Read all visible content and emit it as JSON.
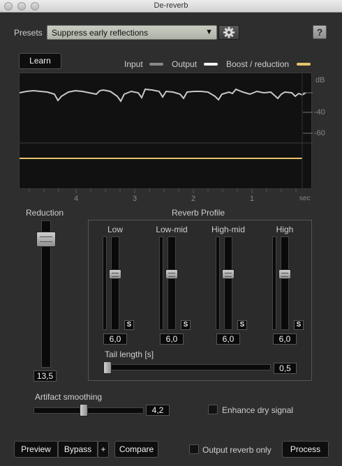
{
  "window": {
    "title": "De-reverb"
  },
  "presets": {
    "label": "Presets",
    "selected": "Suppress early reflections"
  },
  "help_label": "?",
  "learn_label": "Learn",
  "legend": [
    {
      "label": "Input",
      "color": "#8a8a8a"
    },
    {
      "label": "Output",
      "color": "#f4f4f4"
    },
    {
      "label": "Boost / reduction",
      "color": "#e8c46a"
    }
  ],
  "display": {
    "db_label": "dB",
    "db_ticks": [
      "-40",
      "-60"
    ],
    "time_ticks": [
      "4",
      "3",
      "2",
      "1"
    ],
    "time_unit": "sec"
  },
  "reduction": {
    "label": "Reduction",
    "value": "13,5",
    "level": 0.87
  },
  "reverb_profile": {
    "title": "Reverb Profile",
    "bands": [
      {
        "label": "Low",
        "value": "6,0",
        "solo": "S",
        "level": 0.6
      },
      {
        "label": "Low-mid",
        "value": "6,0",
        "solo": "S",
        "level": 0.6
      },
      {
        "label": "High-mid",
        "value": "6,0",
        "solo": "S",
        "level": 0.6
      },
      {
        "label": "High",
        "value": "6,0",
        "solo": "S",
        "level": 0.6
      }
    ],
    "tail_length": {
      "label": "Tail length [s]",
      "value": "0,5",
      "level": 0.0
    }
  },
  "artifact_smoothing": {
    "label": "Artifact smoothing",
    "value": "4,2",
    "level": 0.42
  },
  "enhance_dry": {
    "label": "Enhance dry signal",
    "checked": false
  },
  "footer": {
    "preview_label": "Preview",
    "bypass_label": "Bypass",
    "plus_label": "+",
    "compare_label": "Compare",
    "output_reverb_only_label": "Output reverb only",
    "process_label": "Process"
  }
}
